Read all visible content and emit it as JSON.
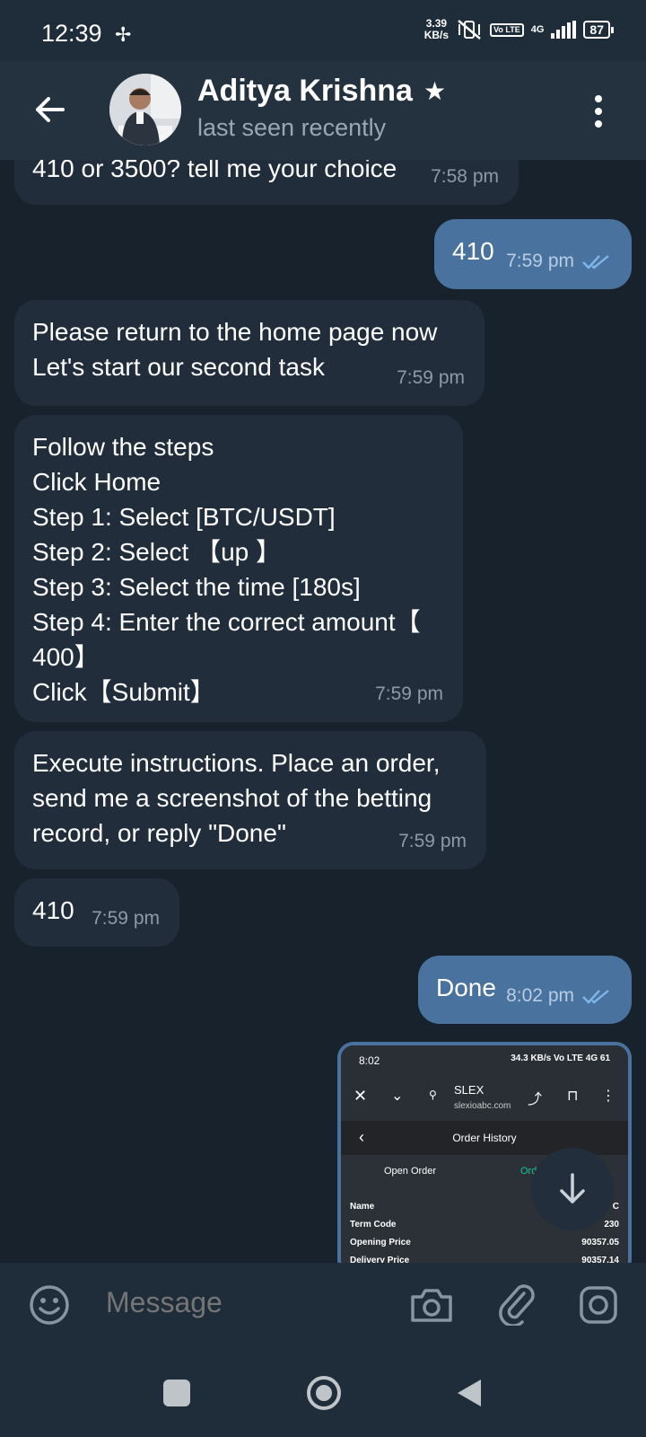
{
  "status": {
    "time": "12:39",
    "speed_value": "3.39",
    "speed_unit": "KB/s",
    "network": "4G",
    "volte": "Vo LTE",
    "battery": "87"
  },
  "header": {
    "name": "Aditya Krishna",
    "status": "last seen recently"
  },
  "messages": [
    {
      "text": "410 or 3500? tell me your choice",
      "time": "7:58 pm"
    },
    {
      "text": "410",
      "time": "7:59 pm"
    },
    {
      "text": "Please return to the home page now\nLet's start our second task",
      "time": "7:59 pm"
    },
    {
      "text": "Follow the steps\nClick Home\nStep 1: Select [BTC/USDT]\nStep 2: Select  【up 】\nStep 3: Select the time [180s]\nStep 4: Enter the correct amount【\n400】\nClick【Submit】",
      "time": "7:59 pm"
    },
    {
      "text": "Execute instructions. Place an order,\nsend me a screenshot of the betting\nrecord, or reply \"Done\"",
      "time": "7:59 pm"
    },
    {
      "text": "410",
      "time": "7:59 pm"
    },
    {
      "text": "Done",
      "time": "8:02 pm"
    }
  ],
  "screenshot": {
    "time": "8:02",
    "status_right": "34.3 KB/s  Vo LTE 4G  61",
    "site": "SLEX",
    "url": "slexioabc.com",
    "title": "Order History",
    "tab_open": "Open Order",
    "tab_closed": "Ord",
    "rows": [
      {
        "label": "Name",
        "value": "C"
      },
      {
        "label": "Term Code",
        "value": "230"
      },
      {
        "label": "Opening Price",
        "value": "90357.05"
      },
      {
        "label": "Delivery Price",
        "value": "90357.14"
      }
    ]
  },
  "composer": {
    "placeholder": "Message"
  },
  "icons": {
    "back": "arrow-left-icon",
    "menu": "more-vertical-icon",
    "emoji": "emoji-icon",
    "camera": "camera-icon",
    "attach": "paperclip-icon",
    "instagram": "instagram-icon"
  }
}
